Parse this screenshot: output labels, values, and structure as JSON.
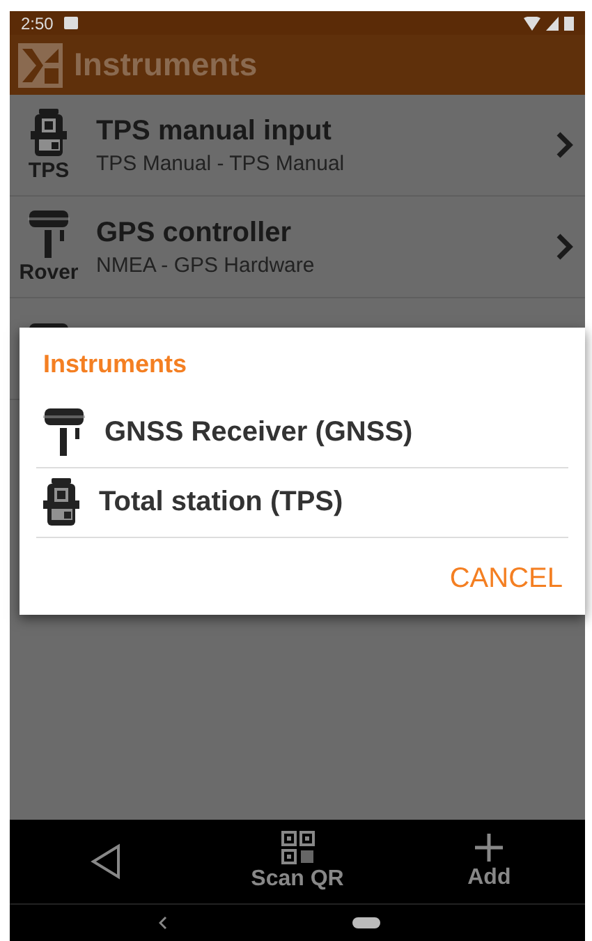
{
  "status_bar": {
    "time": "2:50"
  },
  "app_bar": {
    "title": "Instruments"
  },
  "instruments": [
    {
      "kind": "tps",
      "icon_label": "TPS",
      "title": "TPS manual input",
      "subtitle": "TPS Manual - TPS Manual"
    },
    {
      "kind": "gnss",
      "icon_label": "Rover",
      "title": "GPS controller",
      "subtitle": "NMEA - GPS Hardware"
    },
    {
      "kind": "gnss"
    }
  ],
  "dialog": {
    "title": "Instruments",
    "options": [
      {
        "kind": "gnss",
        "label": "GNSS Receiver (GNSS)"
      },
      {
        "kind": "tps",
        "label": "Total station (TPS)"
      }
    ],
    "cancel": "CANCEL"
  },
  "bottom_bar": [
    {
      "kind": "back"
    },
    {
      "kind": "qr",
      "label": "Scan QR"
    },
    {
      "kind": "add",
      "label": "Add"
    }
  ]
}
